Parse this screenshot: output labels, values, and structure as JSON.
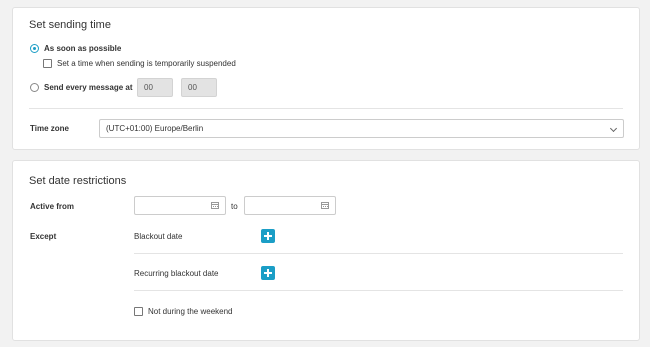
{
  "sending_time": {
    "title": "Set sending time",
    "option_asap": "As soon as possible",
    "suspended_checkbox_label": "Set a time when sending is temporarily suspended",
    "option_every_message": "Send every message at",
    "hour_value": "00",
    "minute_value": "00",
    "timezone_label": "Time zone",
    "timezone_value": "(UTC+01:00) Europe/Berlin"
  },
  "date_restrictions": {
    "title": "Set date restrictions",
    "active_from_label": "Active from",
    "from_value": "",
    "to_label": "to",
    "to_value": "",
    "except_label": "Except",
    "blackout_date_label": "Blackout date",
    "recurring_blackout_label": "Recurring blackout date",
    "weekend_label": "Not during the weekend"
  },
  "colors": {
    "accent": "#1b9ec6",
    "background": "#f2f2f2"
  },
  "icons": [
    "radio-selected-icon",
    "radio-unselected-icon",
    "checkbox-icon",
    "chevron-down-icon",
    "calendar-icon",
    "plus-icon"
  ]
}
